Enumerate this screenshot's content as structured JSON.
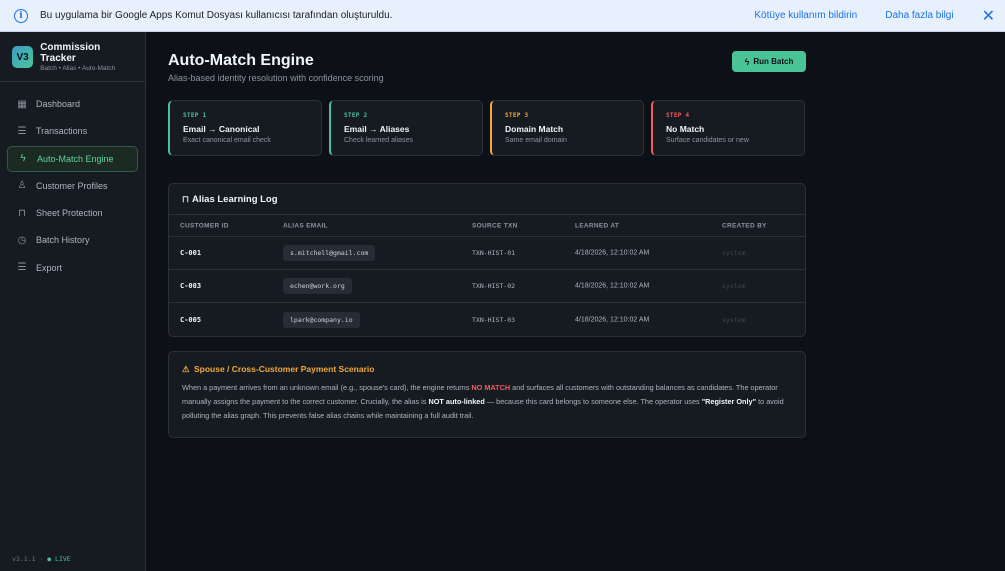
{
  "banner": {
    "message": "Bu uygulama bir Google Apps Komut Dosyası kullanıcısı tarafından oluşturuldu.",
    "report_link": "Kötüye kullanım bildirin",
    "more_link": "Daha fazla bilgi",
    "close_glyph": "✕",
    "info_glyph": "i"
  },
  "brand": {
    "logo_text": "V3",
    "title": "Commission Tracker",
    "subtitle": "Batch • Alias • Auto-Match"
  },
  "nav": {
    "items": [
      {
        "label": "Dashboard",
        "icon": "grid-icon",
        "glyph": "▦"
      },
      {
        "label": "Transactions",
        "icon": "list-icon",
        "glyph": "☰"
      },
      {
        "label": "Auto-Match Engine",
        "icon": "lightning-icon",
        "glyph": "ϟ"
      },
      {
        "label": "Customer Profiles",
        "icon": "user-icon",
        "glyph": "♙"
      },
      {
        "label": "Sheet Protection",
        "icon": "lock-icon",
        "glyph": "⊓"
      },
      {
        "label": "Batch History",
        "icon": "clock-icon",
        "glyph": "◷"
      },
      {
        "label": "Export",
        "icon": "list-icon",
        "glyph": "☰"
      }
    ],
    "active_index": 2
  },
  "footer": {
    "version": "v3.1.1 ·",
    "status": "● LIVE"
  },
  "page": {
    "title": "Auto-Match Engine",
    "subtitle": "Alias-based identity resolution with confidence scoring",
    "run_button": "Run Batch",
    "run_icon": "ϟ"
  },
  "steps": [
    {
      "number": "STEP 1",
      "title": "Email → Canonical",
      "desc": "Exact canonical email check",
      "color": "#4ac496"
    },
    {
      "number": "STEP 2",
      "title": "Email → Aliases",
      "desc": "Check learned aliases",
      "color": "#4ac496"
    },
    {
      "number": "STEP 3",
      "title": "Domain Match",
      "desc": "Same email domain",
      "color": "#f0a93a"
    },
    {
      "number": "STEP 4",
      "title": "No Match",
      "desc": "Surface candidates or new",
      "color": "#f25c5c"
    }
  ],
  "alias_log": {
    "title": "Alias Learning Log",
    "columns": [
      "CUSTOMER ID",
      "ALIAS EMAIL",
      "SOURCE TXN",
      "LEARNED AT",
      "CREATED BY"
    ],
    "rows": [
      {
        "customer_id": "C-001",
        "alias_email": "s.mitchell@gmail.com",
        "source_txn": "TXN-HIST-01",
        "learned_at": "4/18/2026, 12:10:02 AM",
        "created_by": "system"
      },
      {
        "customer_id": "C-003",
        "alias_email": "echen@work.org",
        "source_txn": "TXN-HIST-02",
        "learned_at": "4/18/2026, 12:10:02 AM",
        "created_by": "system"
      },
      {
        "customer_id": "C-005",
        "alias_email": "lpark@company.io",
        "source_txn": "TXN-HIST-03",
        "learned_at": "4/18/2026, 12:10:02 AM",
        "created_by": "system"
      }
    ]
  },
  "scenario": {
    "title": "Spouse / Cross-Customer Payment Scenario",
    "warn_glyph": "⚠",
    "p1": "When a payment arrives from an unknown email (e.g., spouse's card), the engine returns ",
    "no_match": "NO MATCH",
    "p2": " and surfaces all customers with outstanding balances as candidates. The operator manually assigns the payment to the correct customer. Crucially, the alias is ",
    "not_linked": "NOT auto-linked",
    "p3": " — because this card belongs to someone else. The operator uses ",
    "register_only": "\"Register Only\"",
    "p4": " to avoid polluting the alias graph. This prevents false alias chains while maintaining a full audit trail."
  }
}
